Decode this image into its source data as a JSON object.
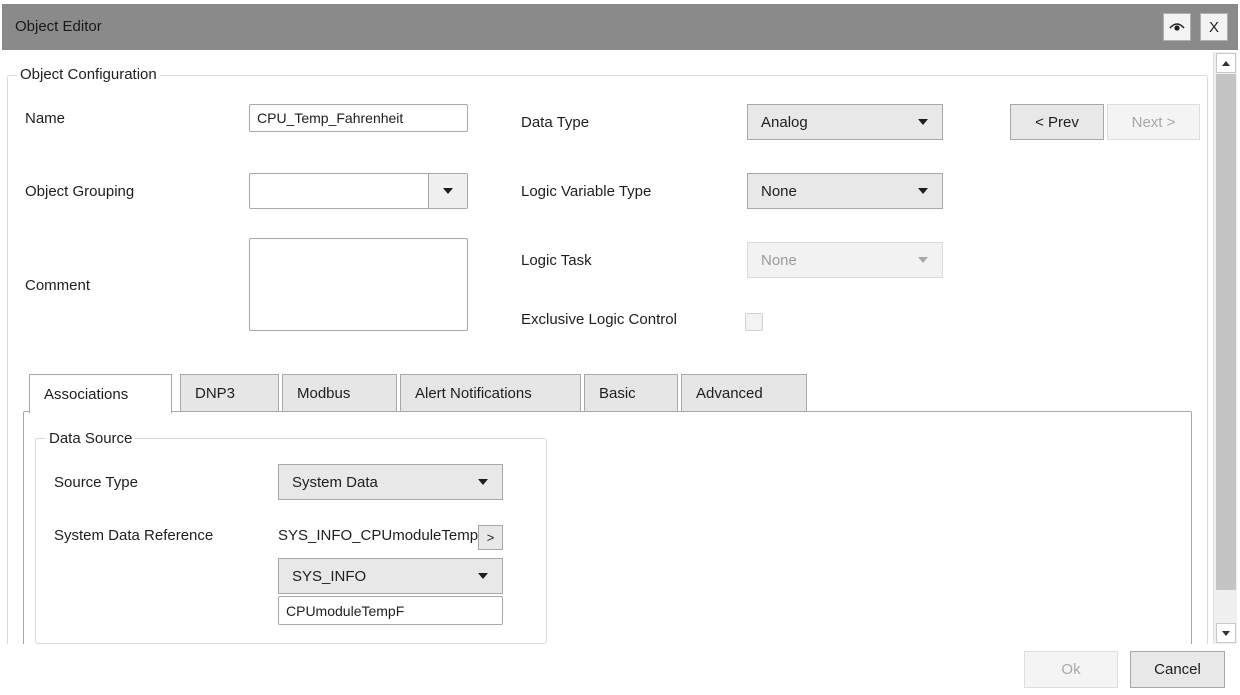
{
  "window": {
    "title": "Object Editor",
    "close_label": "X"
  },
  "config": {
    "legend": "Object Configuration",
    "name_label": "Name",
    "name_value": "CPU_Temp_Fahrenheit",
    "grouping_label": "Object Grouping",
    "grouping_value": "",
    "comment_label": "Comment",
    "comment_value": "",
    "data_type_label": "Data Type",
    "data_type_value": "Analog",
    "logic_var_type_label": "Logic Variable Type",
    "logic_var_type_value": "None",
    "logic_task_label": "Logic Task",
    "logic_task_value": "None",
    "exclusive_label": "Exclusive Logic Control",
    "exclusive_checked": false,
    "prev_label": "< Prev",
    "next_label": "Next >"
  },
  "tabs": [
    {
      "label": "Associations",
      "active": true
    },
    {
      "label": "DNP3",
      "active": false
    },
    {
      "label": "Modbus",
      "active": false
    },
    {
      "label": "Alert Notifications",
      "active": false
    },
    {
      "label": "Basic",
      "active": false
    },
    {
      "label": "Advanced",
      "active": false
    }
  ],
  "data_source": {
    "legend": "Data Source",
    "source_type_label": "Source Type",
    "source_type_value": "System Data",
    "sys_ref_label": "System Data Reference",
    "sys_ref_value": "SYS_INFO_CPUmoduleTempF",
    "expand_label": ">",
    "category_value": "SYS_INFO",
    "item_value": "CPUmoduleTempF"
  },
  "footer": {
    "ok_label": "Ok",
    "cancel_label": "Cancel"
  },
  "icons": {
    "visibility": "eye-icon"
  }
}
